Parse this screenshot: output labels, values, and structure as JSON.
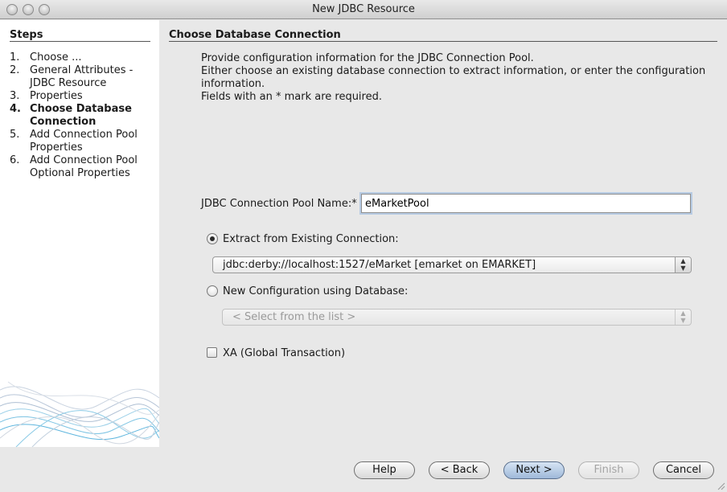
{
  "window": {
    "title": "New JDBC Resource"
  },
  "steps": {
    "title": "Steps",
    "items": [
      {
        "num": "1.",
        "label": "Choose ..."
      },
      {
        "num": "2.",
        "label": "General Attributes - JDBC Resource"
      },
      {
        "num": "3.",
        "label": "Properties"
      },
      {
        "num": "4.",
        "label": "Choose Database Connection"
      },
      {
        "num": "5.",
        "label": "Add Connection Pool Properties"
      },
      {
        "num": "6.",
        "label": "Add Connection Pool Optional Properties"
      }
    ]
  },
  "main": {
    "section_title": "Choose Database Connection",
    "desc_line1": "Provide configuration information for the JDBC Connection Pool.",
    "desc_line2": "Either choose an existing database connection to extract information, or enter the configuration",
    "desc_line3": "information.",
    "desc_line4": "Fields with an * mark are required.",
    "pool_name_label": "JDBC Connection Pool Name:*",
    "pool_name_value": "eMarketPool",
    "extract_label": "Extract from Existing Connection:",
    "extract_selected": "jdbc:derby://localhost:1527/eMarket [emarket on EMARKET]",
    "newconfig_label": "New Configuration using Database:",
    "newconfig_placeholder": "< Select from the list >",
    "xa_label": "XA (Global Transaction)"
  },
  "buttons": {
    "help": "Help",
    "back": "< Back",
    "next": "Next >",
    "finish": "Finish",
    "cancel": "Cancel"
  }
}
